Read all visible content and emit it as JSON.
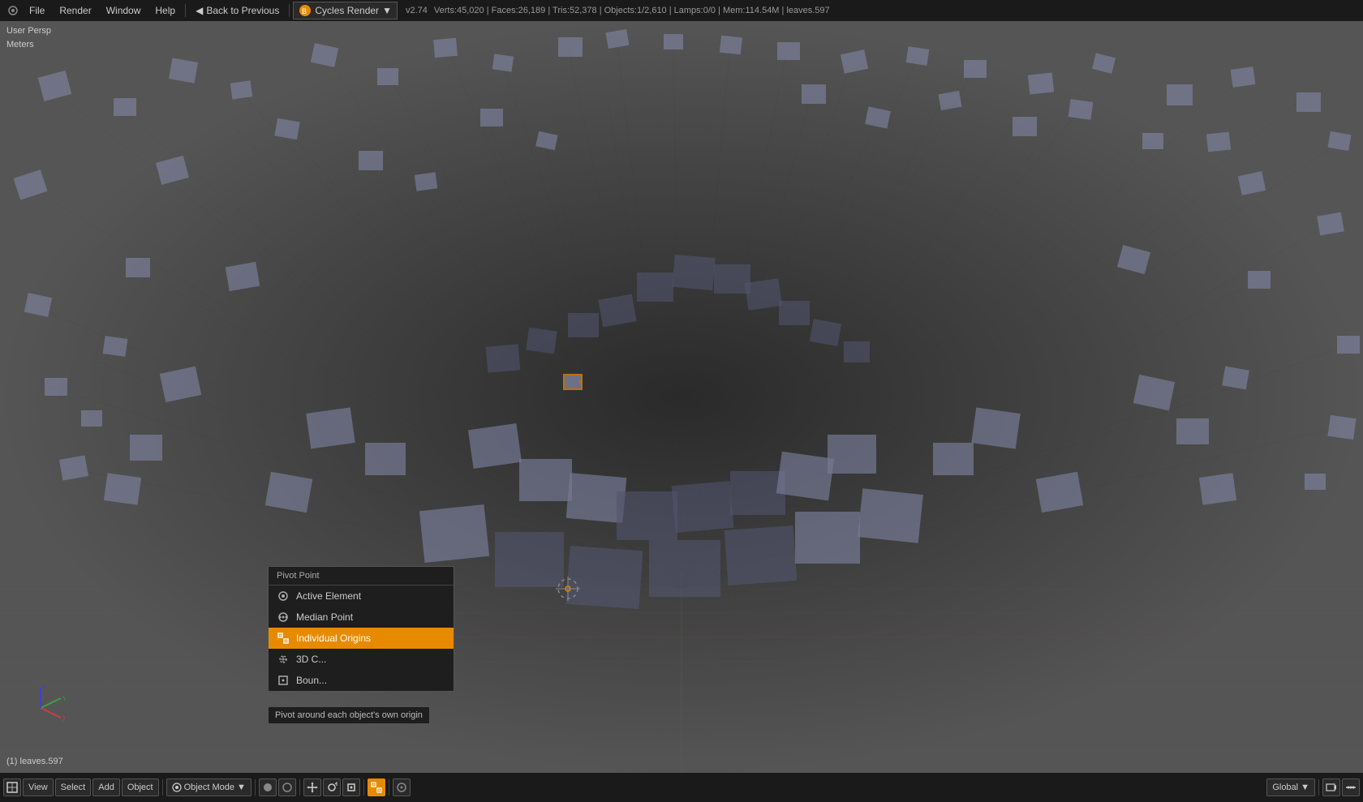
{
  "topbar": {
    "system_icon": "⚙",
    "menus": [
      "File",
      "Render",
      "Window",
      "Help"
    ],
    "back_label": "Back to Previous",
    "engine": "Cycles Render",
    "engine_icon": "▼",
    "blender_version": "v2.74",
    "stats": "Verts:45,020 | Faces:26,189 | Tris:52,378 | Objects:1/2,610 | Lamps:0/0 | Mem:114.54M | leaves.597"
  },
  "viewport": {
    "view_label": "User Persp",
    "unit_label": "Meters",
    "selection_info": "(1) leaves.597"
  },
  "pivot_menu": {
    "title": "Pivot Point",
    "items": [
      {
        "id": "active-element",
        "label": "Active Element",
        "icon": "◎"
      },
      {
        "id": "median-point",
        "label": "Median Point",
        "icon": "⊙"
      },
      {
        "id": "individual-origins",
        "label": "Individual Origins",
        "icon": "⊕",
        "active": true
      },
      {
        "id": "3d-cursor",
        "label": "3D C...",
        "icon": "⊕"
      },
      {
        "id": "bounding-box",
        "label": "Boun...",
        "icon": "□"
      }
    ],
    "tooltip": "Pivot around each object's own origin"
  },
  "bottombar": {
    "view_btn": "View",
    "select_btn": "Select",
    "add_btn": "Add",
    "object_btn": "Object",
    "mode_btn": "Object Mode",
    "global_btn": "Global",
    "icons": [
      "cursor",
      "rotate",
      "scale",
      "render",
      "camera",
      "key",
      "timeline",
      "sequence",
      "graph",
      "dope"
    ]
  }
}
